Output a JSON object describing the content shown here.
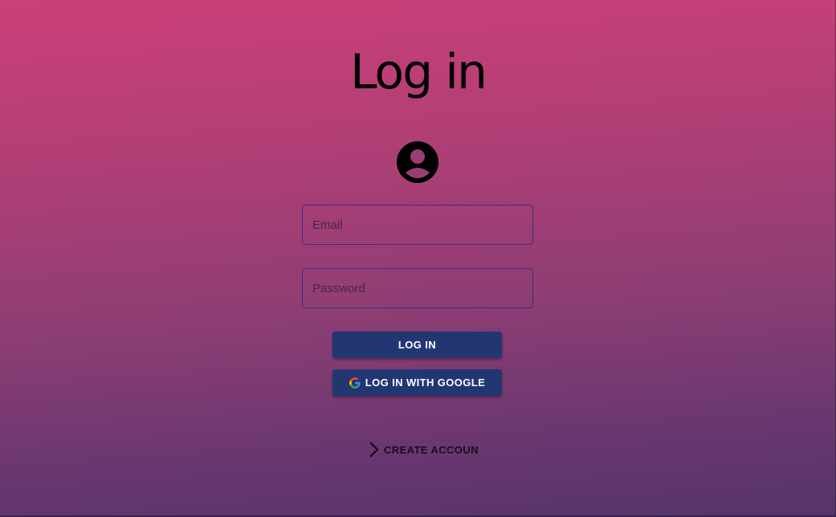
{
  "page": {
    "title": "Log in"
  },
  "form": {
    "email": {
      "placeholder": "Email",
      "value": ""
    },
    "password": {
      "placeholder": "Password",
      "value": ""
    }
  },
  "buttons": {
    "login_label": "LOG IN",
    "google_label": "LOG IN WITH GOOGLE",
    "create_account_label": "CREATE ACCOUN"
  },
  "icons": {
    "avatar": "account-circle-icon",
    "google": "google-g-icon",
    "create_account": "chevron-right-icon"
  },
  "colors": {
    "gradient_top": "#cc3f78",
    "gradient_bottom": "#55336c",
    "button_bg": "#223672",
    "field_border": "#3a2f86"
  }
}
